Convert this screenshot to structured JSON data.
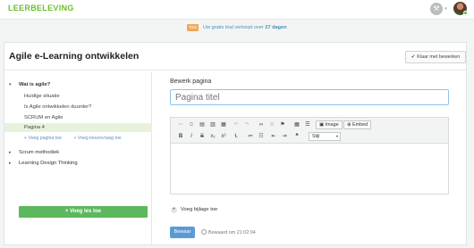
{
  "header": {
    "logo": "LEERBELEVING",
    "settings_icon": "wrench-icon",
    "caret": "▾"
  },
  "trial": {
    "badge": "Trial",
    "text_prefix": "Uw gratis trial verloopt over ",
    "days": "27 dagen"
  },
  "page": {
    "title": "Agile e-Learning ontwikkelen",
    "done_button": "Klaar met bewerken"
  },
  "sidebar": {
    "chapters": [
      {
        "label": "Wat is agile?",
        "expanded": true,
        "pages": [
          {
            "label": "Huidige situatie"
          },
          {
            "label": "Is Agile ontwikkelen duurder?"
          },
          {
            "label": "SCRUM en Agile"
          },
          {
            "label": "Pagina 4",
            "active": true
          }
        ]
      },
      {
        "label": "Scrum methodiek",
        "expanded": false
      },
      {
        "label": "Learning Design Thinking",
        "expanded": false
      }
    ],
    "add_page": "Voeg pagina toe",
    "add_quiz": "Voeg keuzevraag toe",
    "add_lesson": "Voeg les toe"
  },
  "editor": {
    "heading": "Bewerk pagina",
    "title_placeholder": "Pagina titel",
    "image_button": "Image",
    "embed_button": "Embed",
    "style_select": "Stijl",
    "attach_label": "Voeg bijlage toe",
    "save_button": "Bewaar",
    "saved_status": "Bewaard om 21:02:04"
  },
  "colors": {
    "brand_green": "#6abf2e",
    "accent_blue": "#5b9bd5",
    "trial_orange": "#f0a85a",
    "active_row": "#e6f3da"
  }
}
